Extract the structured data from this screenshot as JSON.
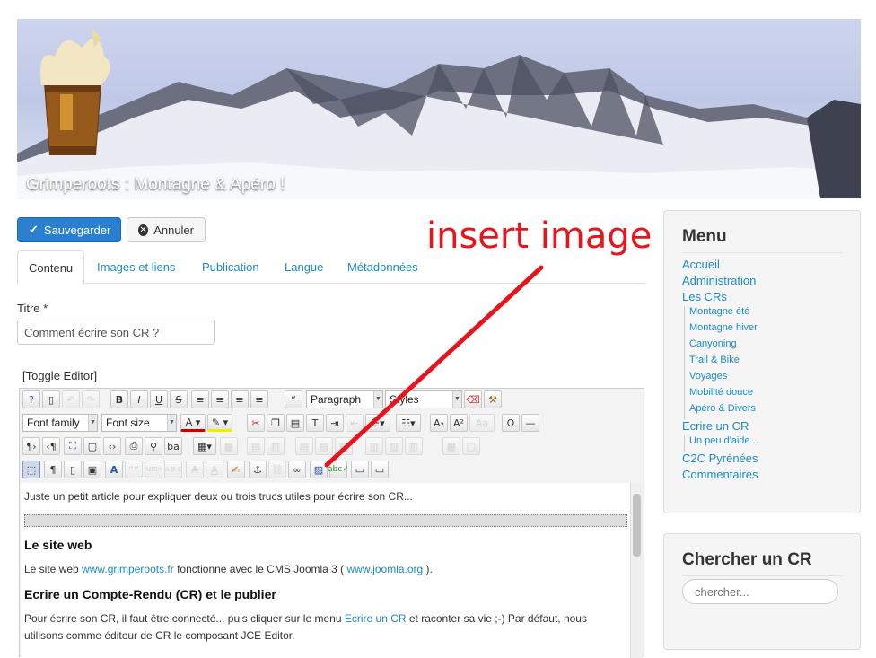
{
  "banner": {
    "site_title": "Grimperoots : Montagne & Apéro !"
  },
  "toolbar": {
    "save_label": "Sauvegarder",
    "cancel_label": "Annuler"
  },
  "tabs": [
    {
      "label": "Contenu"
    },
    {
      "label": "Images et liens"
    },
    {
      "label": "Publication"
    },
    {
      "label": "Langue"
    },
    {
      "label": "Métadonnées"
    }
  ],
  "form": {
    "title_label": "Titre *",
    "title_value": "Comment écrire son CR ?",
    "toggle_editor": "[Toggle Editor]"
  },
  "editor": {
    "format_select": "Paragraph",
    "styles_select": "Styles",
    "font_family_select": "Font family",
    "font_size_select": "Font size",
    "intro": "Juste un petit article pour expliquer deux ou trois trucs utiles pour écrire son CR...",
    "h_site": "Le site web",
    "site_p_start": "Le site web ",
    "site_link": "www.grimperoots.fr",
    "site_p_mid": " fonctionne avec le CMS Joomla 3 ( ",
    "joomla_link": "www.joomla.org",
    "site_p_end": " ).",
    "h_cr": "Ecrire un Compte-Rendu (CR) et le publier",
    "cr_p_start": "Pour écrire son CR, il faut être connecté... puis cliquer sur le menu ",
    "cr_link": "Ecrire un CR",
    "cr_p_end": " et raconter sa vie ;-) Par défaut, nous utilisons comme éditeur de CR le composant JCE Editor."
  },
  "menu": {
    "title": "Menu",
    "items": [
      {
        "label": "Accueil"
      },
      {
        "label": "Administration"
      },
      {
        "label": "Les CRs"
      },
      {
        "label": "Montagne été"
      },
      {
        "label": "Montagne hiver"
      },
      {
        "label": "Canyoning"
      },
      {
        "label": "Trail & Bike"
      },
      {
        "label": "Voyages"
      },
      {
        "label": "Mobilité douce"
      },
      {
        "label": "Apéro & Divers"
      },
      {
        "label": "Ecrire un CR"
      },
      {
        "label": "Un peu d'aide..."
      },
      {
        "label": "C2C Pyrénées"
      },
      {
        "label": "Commentaires"
      }
    ]
  },
  "search": {
    "title": "Chercher un CR",
    "placeholder": "chercher..."
  },
  "annotation": {
    "text": "insert image",
    "color": "#e8141c"
  }
}
